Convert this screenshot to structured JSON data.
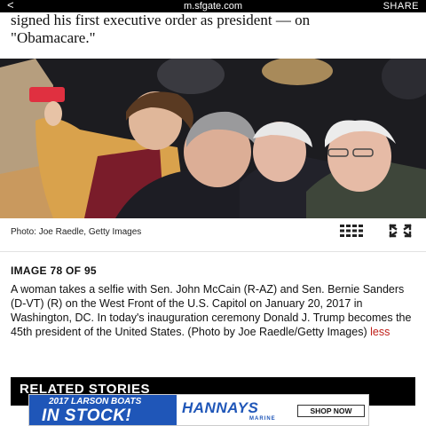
{
  "topbar": {
    "back_label": "<",
    "url": "m.sfgate.com",
    "share_label": "SHARE"
  },
  "article": {
    "line1": "signed his first executive order as president — on",
    "line2": "\"Obamacare.\""
  },
  "photo": {
    "credit": "Photo: Joe Raedle, Getty Images"
  },
  "gallery": {
    "counter": "IMAGE 78 OF 95",
    "description": "A woman takes a selfie with Sen. John McCain (R-AZ) and Sen. Bernie Sanders (D-VT) (R) on the West Front of the U.S. Capitol on January 20, 2017 in Washington, DC. In today's inauguration ceremony Donald J. Trump becomes the 45th president of the United States. (Photo by Joe Raedle/Getty Images) ",
    "less_label": "less"
  },
  "related": {
    "title": "RELATED STORIES"
  },
  "ad": {
    "top_text": "2017 LARSON BOATS",
    "main_text": "IN STOCK!",
    "brand": "HANNAYS",
    "brand_sub": "MARINE",
    "cta": "SHOP NOW"
  },
  "colors": {
    "link": "#c0201a",
    "ad_blue": "#1f56b8"
  }
}
